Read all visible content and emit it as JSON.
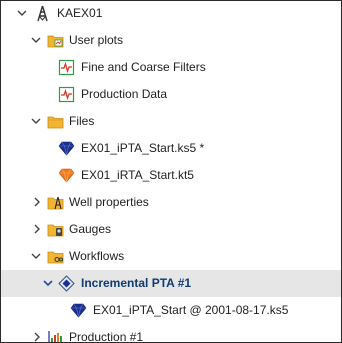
{
  "tree": {
    "root": {
      "label": "KAEX01",
      "icon": "tower-icon",
      "expanded": true
    },
    "user_plots": {
      "label": "User plots",
      "icon": "folder-chart-icon",
      "expanded": true,
      "items": [
        {
          "label": "Fine and Coarse Filters",
          "icon": "plot-icon"
        },
        {
          "label": "Production Data",
          "icon": "plot-icon"
        }
      ]
    },
    "files": {
      "label": "Files",
      "icon": "folder-icon",
      "expanded": true,
      "items": [
        {
          "label": "EX01_iPTA_Start.ks5 *",
          "icon": "blue-diamond-icon",
          "color": "#1b2f8f"
        },
        {
          "label": "EX01_iRTA_Start.kt5",
          "icon": "orange-diamond-icon",
          "color": "#f07a1a"
        }
      ]
    },
    "well_properties": {
      "label": "Well properties",
      "icon": "folder-well-icon",
      "expanded": false
    },
    "gauges": {
      "label": "Gauges",
      "icon": "folder-gauge-icon",
      "expanded": false
    },
    "workflows": {
      "label": "Workflows",
      "icon": "folder-workflow-icon",
      "expanded": true,
      "items": [
        {
          "label": "Incremental PTA #1",
          "icon": "pta-icon",
          "selected": true,
          "expanded": true,
          "children": [
            {
              "label": "EX01_iPTA_Start @ 2001-08-17.ks5",
              "icon": "blue-diamond-icon"
            }
          ]
        }
      ]
    },
    "production": {
      "label": "Production #1",
      "icon": "production-icon",
      "expanded": false
    }
  },
  "colors": {
    "selection": "#e6e6e6",
    "selected_text": "#0f3a72",
    "chevron": "#444444",
    "folder": "#f2b531",
    "plot_green": "#2e9b44",
    "plot_red": "#d9342b"
  }
}
